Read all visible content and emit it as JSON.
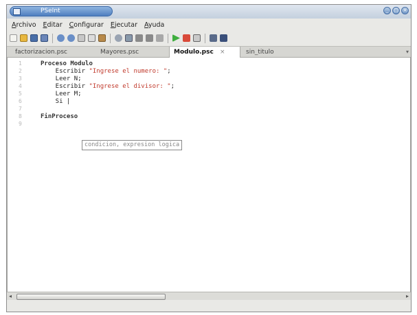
{
  "window": {
    "title": "PSeInt",
    "controls": [
      {
        "name": "minimize",
        "glyph": "_"
      },
      {
        "name": "maximize",
        "glyph": "□"
      },
      {
        "name": "close",
        "glyph": "×"
      }
    ]
  },
  "menu": [
    "Archivo",
    "Editar",
    "Configurar",
    "Ejecutar",
    "Ayuda"
  ],
  "tabs": [
    {
      "label": "factorizacion.psc",
      "active": false
    },
    {
      "label": "Mayores.psc",
      "active": false
    },
    {
      "label": "Modulo.psc",
      "active": true
    },
    {
      "label": "sin_titulo",
      "active": false
    }
  ],
  "tab_close_glyph": "×",
  "tab_menu_glyph": "▾",
  "editor": {
    "lines": [
      {
        "n": "1",
        "parts": [
          {
            "t": "Proceso Modulo",
            "c": "kw"
          }
        ]
      },
      {
        "n": "2",
        "parts": [
          {
            "t": "    Escribir ",
            "c": ""
          },
          {
            "t": "\"Ingrese el numero: \"",
            "c": "str"
          },
          {
            "t": ";",
            "c": ""
          }
        ]
      },
      {
        "n": "3",
        "parts": [
          {
            "t": "    Leer N;",
            "c": ""
          }
        ]
      },
      {
        "n": "4",
        "parts": [
          {
            "t": "    Escribir ",
            "c": ""
          },
          {
            "t": "\"Ingrese el divisor: \"",
            "c": "str"
          },
          {
            "t": ";",
            "c": ""
          }
        ]
      },
      {
        "n": "5",
        "parts": [
          {
            "t": "    Leer M;",
            "c": ""
          }
        ]
      },
      {
        "n": "6",
        "parts": [
          {
            "t": "    Si |",
            "c": ""
          }
        ]
      },
      {
        "n": "7",
        "parts": [
          {
            "t": "",
            "c": ""
          }
        ]
      },
      {
        "n": "8",
        "parts": [
          {
            "t": "FinProceso",
            "c": "kw"
          }
        ]
      },
      {
        "n": "9",
        "parts": [
          {
            "t": "",
            "c": ""
          }
        ]
      }
    ],
    "tooltip": "condicion, expresion logica"
  },
  "colors": {
    "string": "#c0392b",
    "titlebar_accent": "#4f7fc0"
  },
  "toolbar_icons": [
    "new-file-icon",
    "open-file-icon",
    "save-icon",
    "save-as-icon",
    "undo-icon",
    "redo-icon",
    "cut-icon",
    "copy-icon",
    "paste-icon",
    "find-icon",
    "replace-icon",
    "indent-icon",
    "unindent-icon",
    "comment-icon",
    "run-icon",
    "step-icon",
    "debug-icon",
    "flowchart-icon",
    "help-icon"
  ]
}
